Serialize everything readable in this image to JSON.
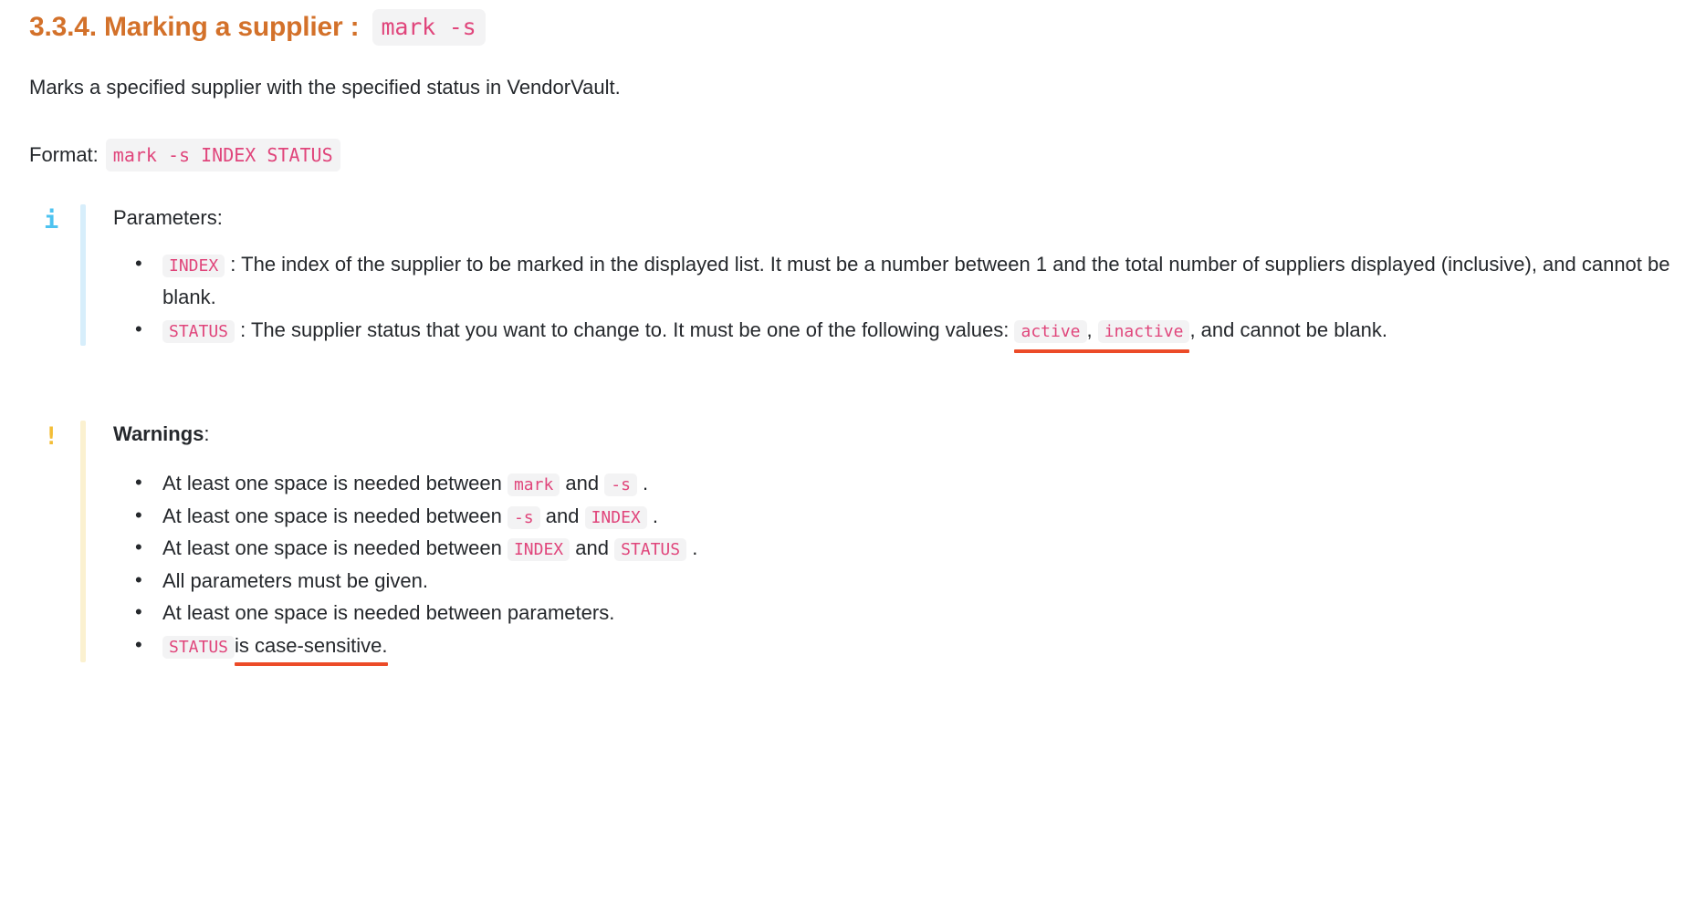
{
  "heading": {
    "text": "3.3.4. Marking a supplier : ",
    "code": "mark -s",
    "color": "#d3712a"
  },
  "description": "Marks a specified supplier with the specified status in VendorVault.",
  "format": {
    "label": "Format:",
    "code": "mark -s INDEX STATUS"
  },
  "info_callout": {
    "icon": "info-icon",
    "icon_glyph": "i",
    "bar_color": "#d7eefb",
    "icon_color": "#4ec3f0",
    "title": "Parameters:",
    "items": [
      {
        "code": "INDEX",
        "text_before_colon": " : ",
        "text": "The index of the supplier to be marked in the displayed list. It must be a number between 1 and the total number of suppliers displayed (inclusive), and cannot be blank."
      },
      {
        "code": "STATUS",
        "text_before_colon": " : ",
        "text_part1": "The supplier status that you want to change to. It must be one of the following values: ",
        "value_1": "active",
        "value_sep": ", ",
        "value_2": "inactive",
        "text_part2": ", and cannot be blank.",
        "annotation": "red-underline"
      }
    ]
  },
  "warning_callout": {
    "icon": "warning-icon",
    "icon_glyph": "!",
    "bar_color": "#fbf1d0",
    "icon_color": "#f3bd36",
    "title": "Warnings",
    "title_suffix": ":",
    "items": [
      {
        "prefix": "At least one space is needed between ",
        "code1": "mark",
        "mid": " and ",
        "code2": "-s",
        "suffix": " ."
      },
      {
        "prefix": "At least one space is needed between ",
        "code1": "-s",
        "mid": " and ",
        "code2": "INDEX",
        "suffix": " ."
      },
      {
        "prefix": "At least one space is needed between ",
        "code1": "INDEX",
        "mid": " and ",
        "code2": "STATUS",
        "suffix": " ."
      },
      {
        "plain": "All parameters must be given."
      },
      {
        "plain": "At least one space is needed between parameters."
      },
      {
        "code1": "STATUS",
        "underlined": " is case-sensitive.",
        "annotation": "red-underline"
      }
    ]
  },
  "colors": {
    "accent_heading": "#d3712a",
    "code_text": "#e0457b",
    "code_bg": "#f3f3f4",
    "annotation_red": "#ec4b28",
    "body_text": "#25282c"
  }
}
